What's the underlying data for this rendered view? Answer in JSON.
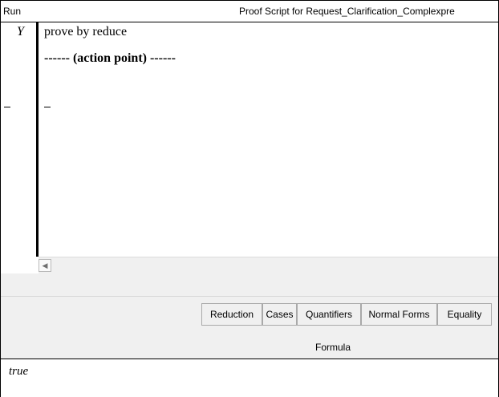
{
  "header": {
    "run_label": "Run",
    "title": "Proof Script for Request_Clarification_Complexpre"
  },
  "script": {
    "status_marker": "Y",
    "lines": [
      "prove by reduce",
      "------ (action point) ------"
    ]
  },
  "scrollbar": {
    "left_arrow_icon": "chevron-left-icon"
  },
  "tabs": [
    {
      "label": "Reduction"
    },
    {
      "label": "Cases"
    },
    {
      "label": "Quantifiers"
    },
    {
      "label": "Normal Forms"
    },
    {
      "label": "Equality"
    }
  ],
  "panel": {
    "section_label": "Formula"
  },
  "result": {
    "text": "true"
  }
}
